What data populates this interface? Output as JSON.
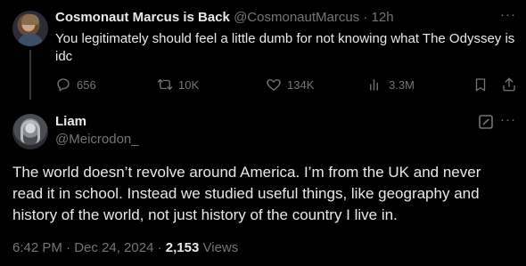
{
  "parent_tweet": {
    "display_name": "Cosmonaut Marcus is Back",
    "handle": "@CosmonautMarcus",
    "separator": "·",
    "time": "12h",
    "text": "You legitimately should feel a little dumb for not knowing what The Odyssey is idc",
    "actions": {
      "replies": "656",
      "reposts": "10K",
      "likes": "134K",
      "views": "3.3M"
    }
  },
  "reply_tweet": {
    "display_name": "Liam",
    "handle": "@Meicrodon_",
    "text": "The world doesn’t revolve around America.  I’m from the UK and never read it in school. Instead we studied useful things, like geography and history of the world, not just history of the country I live in.",
    "timestamp": "6:42 PM · Dec 24, 2024",
    "separator": "·",
    "views_count": "2,153",
    "views_label": "Views"
  },
  "icons": {
    "more": "more-icon",
    "reply": "reply-icon",
    "repost": "repost-icon",
    "like": "like-icon",
    "views": "views-icon",
    "bookmark": "bookmark-icon",
    "share": "share-icon",
    "edit": "edit-icon"
  },
  "colors": {
    "background": "#000000",
    "primary_text": "#e7e9ea",
    "secondary_text": "#71767b",
    "thread_line": "#333639"
  }
}
